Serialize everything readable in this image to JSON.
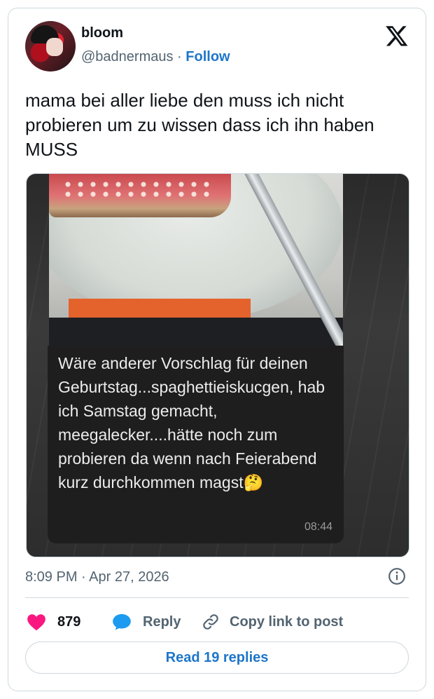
{
  "author": {
    "name": "bloom",
    "handle": "@badnermaus",
    "separator": "·",
    "follow_label": "Follow"
  },
  "tweet": {
    "text": "mama bei aller liebe den muss ich nicht probieren um zu wissen dass ich ihn haben MUSS"
  },
  "media": {
    "message_text": "Wäre anderer Vorschlag für deinen Geburtstag...spaghettieiskucgen, hab ich Samstag gemacht, meegalecker....hätte noch zum probieren da wenn nach Feierabend kurz durchkommen magst🤔",
    "message_time": "08:44"
  },
  "meta": {
    "timestamp": "8:09 PM · Apr 27, 2026"
  },
  "actions": {
    "like_count": "879",
    "reply_label": "Reply",
    "copy_link_label": "Copy link to post"
  },
  "read_replies_label": "Read 19 replies",
  "icons": {
    "x_logo": "x-logo-icon",
    "info": "info-icon",
    "heart": "heart-icon",
    "reply": "speech-bubble-icon",
    "link": "link-icon"
  },
  "colors": {
    "accent": "#1d76c8",
    "like": "#f91880",
    "reply_icon": "#1d9bf0",
    "muted": "#536471",
    "border": "#cfd9de"
  }
}
